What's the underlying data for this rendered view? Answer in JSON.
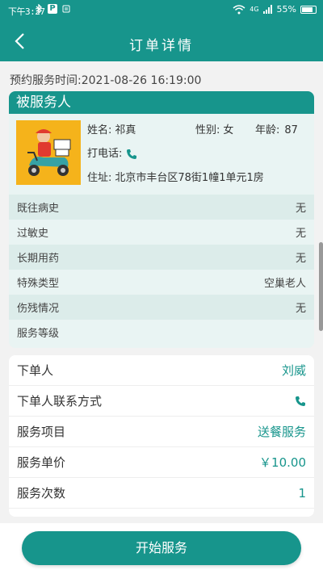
{
  "colors": {
    "accent": "#17958c"
  },
  "status_bar": {
    "time": "下午3:27",
    "signal_label": "4G",
    "battery_text": "55%"
  },
  "header": {
    "title": "订单详情",
    "back_icon": "chevron-left-icon"
  },
  "booking": {
    "label": "预约服务时间:",
    "value": "2021-08-26 16:19:00"
  },
  "served_person": {
    "section_title": "被服务人",
    "name_label": "姓名:",
    "name": "祁真",
    "gender_label": "性别:",
    "gender": "女",
    "age_label": "年龄:",
    "age": "87",
    "phone_label": "打电话:",
    "address_label": "住址:",
    "address": "北京市丰台区78街1幢1单元1房",
    "rows": [
      {
        "label": "既往病史",
        "value": "无"
      },
      {
        "label": "过敏史",
        "value": "无"
      },
      {
        "label": "长期用药",
        "value": "无"
      },
      {
        "label": "特殊类型",
        "value": "空巢老人"
      },
      {
        "label": "伤残情况",
        "value": "无"
      },
      {
        "label": "服务等级",
        "value": ""
      }
    ]
  },
  "order": {
    "rows": [
      {
        "label": "下单人",
        "value": "刘威"
      },
      {
        "label": "下单人联系方式",
        "value": ""
      },
      {
        "label": "服务项目",
        "value": "送餐服务"
      },
      {
        "label": "服务单价",
        "value": "￥10.00"
      },
      {
        "label": "服务次数",
        "value": "1"
      }
    ]
  },
  "actions": {
    "start_label": "开始服务"
  }
}
